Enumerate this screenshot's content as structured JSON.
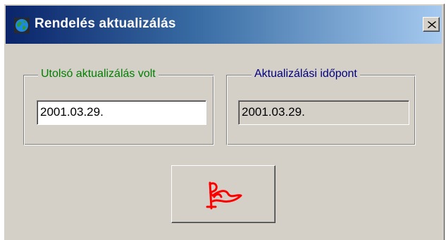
{
  "window": {
    "title": "Rendelés aktualizálás",
    "title_icon": "globe-icon",
    "close_icon": "close-icon"
  },
  "last_update_group": {
    "label": "Utolsó aktualizálás volt",
    "value": "2001.03.29.",
    "label_color": "#008000"
  },
  "update_time_group": {
    "label": "Aktualizálási időpont",
    "value": "2001.03.29.",
    "label_color": "#000080"
  },
  "action_button": {
    "icon": "red-flag-icon",
    "icon_color": "#ff0000"
  },
  "colors": {
    "titlebar_start": "#0a246a",
    "titlebar_end": "#a6caf0",
    "face": "#d4d0c8"
  }
}
